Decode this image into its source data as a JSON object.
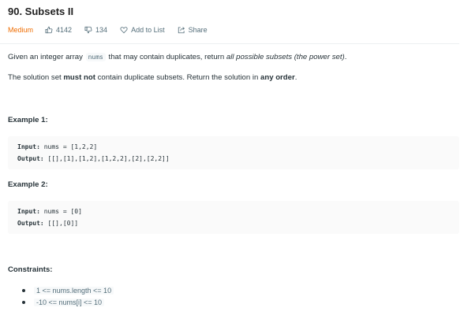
{
  "problem": {
    "title": "90. Subsets II",
    "difficulty": "Medium",
    "likes": "4142",
    "dislikes": "134",
    "add_to_list": "Add to List",
    "share": "Share"
  },
  "description": {
    "p1_before": "Given an integer array",
    "p1_code": "nums",
    "p1_middle": "that may contain duplicates, return",
    "p1_em": "all possible subsets (the power set)",
    "p1_end": ".",
    "p2_before": "The solution set",
    "p2_strong": "must not",
    "p2_middle": "contain duplicate subsets. Return the solution in",
    "p2_strong2": "any order",
    "p2_end": "."
  },
  "examples": [
    {
      "heading": "Example 1:",
      "input_label": "Input:",
      "input_value": "nums = [1,2,2]",
      "output_label": "Output:",
      "output_value": "[[],[1],[1,2],[1,2,2],[2],[2,2]]"
    },
    {
      "heading": "Example 2:",
      "input_label": "Input:",
      "input_value": "nums = [0]",
      "output_label": "Output:",
      "output_value": "[[],[0]]"
    }
  ],
  "constraints": {
    "heading": "Constraints:",
    "items": [
      "1 <= nums.length <= 10",
      "-10 <= nums[i] <= 10"
    ]
  },
  "colors": {
    "difficulty_medium": "#ef6c00",
    "muted_text": "#546e7a",
    "code_bg": "#fafafa"
  },
  "icons": {
    "likes": "thumbs-up-icon",
    "dislikes": "thumbs-down-icon",
    "add_to_list": "heart-icon",
    "share": "share-icon"
  }
}
